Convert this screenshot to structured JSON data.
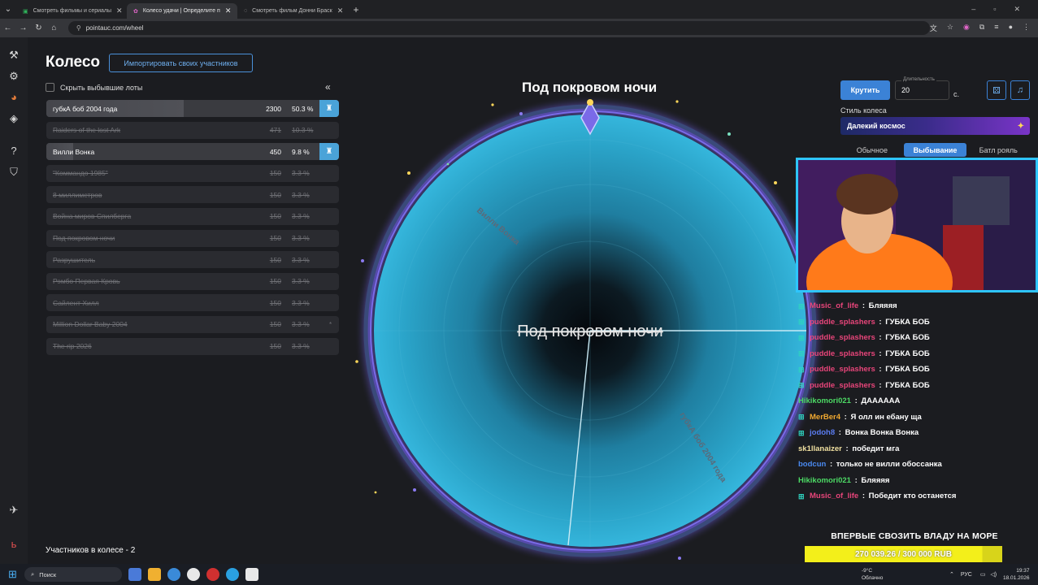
{
  "browser": {
    "tabs": [
      {
        "title": "Смотреть фильмы и сериалы"
      },
      {
        "title": "Колесо удачи | Определите п"
      },
      {
        "title": "Смотреть фильм Донни Браск"
      }
    ],
    "url": "pointauc.com/wheel"
  },
  "page": {
    "title": "Колесо",
    "import_button": "Импортировать своих участников",
    "hide_label": "Скрыть выбывшие лоты",
    "participants_count": "Участников в колесе - 2"
  },
  "lots": [
    {
      "name": "губкА боб 2004 года",
      "amount": "2300",
      "pct": "50.3 %",
      "active": true,
      "share": 0.503
    },
    {
      "name": "Raiders of the lost Ark",
      "amount": "471",
      "pct": "10.3 %",
      "active": false
    },
    {
      "name": "Вилли Вонка",
      "amount": "450",
      "pct": "9.8 %",
      "active": true,
      "share": 0.098
    },
    {
      "name": "\"Коммандо 1985\"",
      "amount": "150",
      "pct": "3.3 %",
      "active": false
    },
    {
      "name": "8 миллиметров",
      "amount": "150",
      "pct": "3.3 %",
      "active": false
    },
    {
      "name": "Война миров Спилберга",
      "amount": "150",
      "pct": "3.3 %",
      "active": false
    },
    {
      "name": "Под покровом ночи",
      "amount": "150",
      "pct": "3.3 %",
      "active": false
    },
    {
      "name": "Разрушитель",
      "amount": "150",
      "pct": "3.3 %",
      "active": false
    },
    {
      "name": "Рэмбо Первая Кровь",
      "amount": "150",
      "pct": "3.3 %",
      "active": false
    },
    {
      "name": "Сайлент Хилл",
      "amount": "150",
      "pct": "3.3 %",
      "active": false
    },
    {
      "name": "Million Dollar Baby 2004",
      "amount": "150",
      "pct": "3.3 %",
      "active": false,
      "mark": "*"
    },
    {
      "name": "The rip 2026",
      "amount": "150",
      "pct": "3.3 %",
      "active": false
    }
  ],
  "wheel": {
    "title": "Под покровом ночи",
    "center_text": "Под покровом ночи",
    "segment_labels": [
      "Вилли Вонка",
      "губкА боб 2004 года"
    ]
  },
  "controls": {
    "spin_button": "Крутить",
    "duration_label": "Длительность",
    "duration_value": "20",
    "duration_unit": "с.",
    "style_label": "Стиль колеса",
    "style_value": "Далекий космос",
    "modes": [
      "Обычное",
      "Выбывание",
      "Батл рояль"
    ],
    "active_mode": "Выбывание"
  },
  "chat": [
    {
      "user": "Music_of_life",
      "msg": "Бляяяя",
      "color": "#e8457a",
      "badge": true
    },
    {
      "user": "puddle_splashers",
      "msg": "ГУБКА БОБ",
      "color": "#e8457a",
      "badge": true
    },
    {
      "user": "puddle_splashers",
      "msg": "ГУБКА БОБ",
      "color": "#e8457a",
      "badge": true
    },
    {
      "user": "puddle_splashers",
      "msg": "ГУБКА БОБ",
      "color": "#e8457a",
      "badge": true
    },
    {
      "user": "puddle_splashers",
      "msg": "ГУБКА БОБ",
      "color": "#e8457a",
      "badge": true
    },
    {
      "user": "puddle_splashers",
      "msg": "ГУБКА БОБ",
      "color": "#e8457a",
      "badge": true
    },
    {
      "user": "Hikikomori021",
      "msg": "ДАААААА",
      "color": "#4cd964",
      "badge": false
    },
    {
      "user": "MerBer4",
      "msg": "Я олл ин ебану ща",
      "color": "#f0a830",
      "badge": true
    },
    {
      "user": "jodoh8",
      "msg": "Вонка Вонка Вонка",
      "color": "#5a7cf0",
      "badge": true
    },
    {
      "user": "sk1llanaizer",
      "msg": "победит мга",
      "color": "#f0e0a0",
      "badge": false
    },
    {
      "user": "bodcun",
      "msg": "только не вилли обоссанка",
      "color": "#4a8af0",
      "badge": false
    },
    {
      "user": "Hikikomori021",
      "msg": "Бляяяя",
      "color": "#4cd964",
      "badge": false
    },
    {
      "user": "Music_of_life",
      "msg": "Победит кто останется",
      "color": "#e8457a",
      "badge": true
    }
  ],
  "goal": {
    "title": "ВПЕРВЫЕ СВОЗИТЬ ВЛАДУ НА МОРЕ",
    "progress_text": "270 039.26 / 300 000 RUB",
    "progress_fraction": 0.9
  },
  "taskbar": {
    "search": "Поиск",
    "weather_temp": "-9°C",
    "weather_desc": "Облачно",
    "lang": "РУС",
    "time": "19:37",
    "date": "18.01.2026"
  },
  "colors": {
    "accent": "#3b82d6",
    "wheel": "#2aa3c8",
    "goal_bar": "#f3ef1a"
  }
}
